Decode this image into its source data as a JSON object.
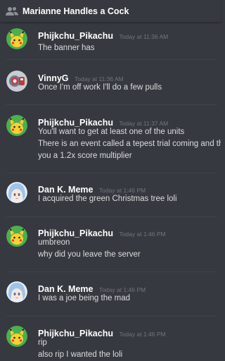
{
  "header": {
    "channel_title": "Marianne Handles a Cock",
    "icon": "people-icon"
  },
  "messages": [
    {
      "author": "Phijkchu_Pikachu",
      "timestamp": "Today at 11:36 AM",
      "avatar": "pikachu-avatar",
      "lines": [
        "The banner has"
      ]
    },
    {
      "author": "VinnyG",
      "timestamp": "Today at 11:36 AM",
      "avatar": "vinnyg-avatar",
      "lines": [
        "Once I'm off work I'll do a few pulls"
      ]
    },
    {
      "author": "Phijkchu_Pikachu",
      "timestamp": "Today at 11:37 AM",
      "avatar": "pikachu-avatar",
      "lines": [
        "You'll want to get at least one of the units",
        "There is an event called a tepest trial coming and thos",
        "you a 1.2x score multiplier"
      ]
    },
    {
      "author": "Dan K. Meme",
      "timestamp": "Today at 1:46 PM",
      "avatar": "anime-girl-avatar",
      "lines": [
        "I acquired the green Christmas tree loli"
      ]
    },
    {
      "author": "Phijkchu_Pikachu",
      "timestamp": "Today at 1:46 PM",
      "avatar": "pikachu-avatar",
      "lines": [
        "umbreon",
        "why did you leave the server"
      ]
    },
    {
      "author": "Dan K. Meme",
      "timestamp": "Today at 1:46 PM",
      "avatar": "anime-girl-avatar",
      "lines": [
        "I was a joe being the mad"
      ]
    },
    {
      "author": "Phijkchu_Pikachu",
      "timestamp": "Today at 1:46 PM",
      "avatar": "pikachu-avatar",
      "lines": [
        "rip",
        "also rip I wanted the loli"
      ]
    }
  ]
}
